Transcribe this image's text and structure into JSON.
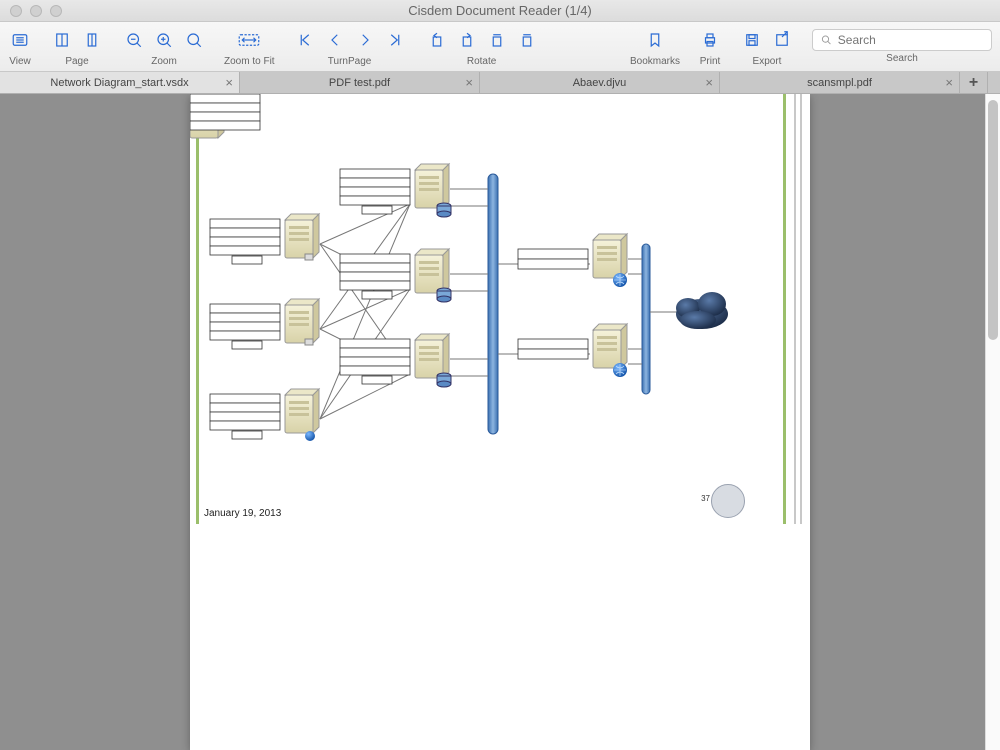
{
  "window": {
    "title": "Cisdem Document Reader (1/4)"
  },
  "toolbar": {
    "view": "View",
    "page": "Page",
    "zoom": "Zoom",
    "zoomtofit": "Zoom to Fit",
    "turnpage": "TurnPage",
    "rotate": "Rotate",
    "bookmarks": "Bookmarks",
    "print": "Print",
    "export": "Export",
    "search_label": "Search",
    "search_placeholder": "Search"
  },
  "tabs": [
    {
      "label": "Network Diagram_start.vsdx",
      "active": true
    },
    {
      "label": "PDF test.pdf",
      "active": false
    },
    {
      "label": "Abaev.djvu",
      "active": false
    },
    {
      "label": "scansmpl.pdf",
      "active": false
    }
  ],
  "document": {
    "date": "January 19, 2013",
    "page_number": "37"
  }
}
